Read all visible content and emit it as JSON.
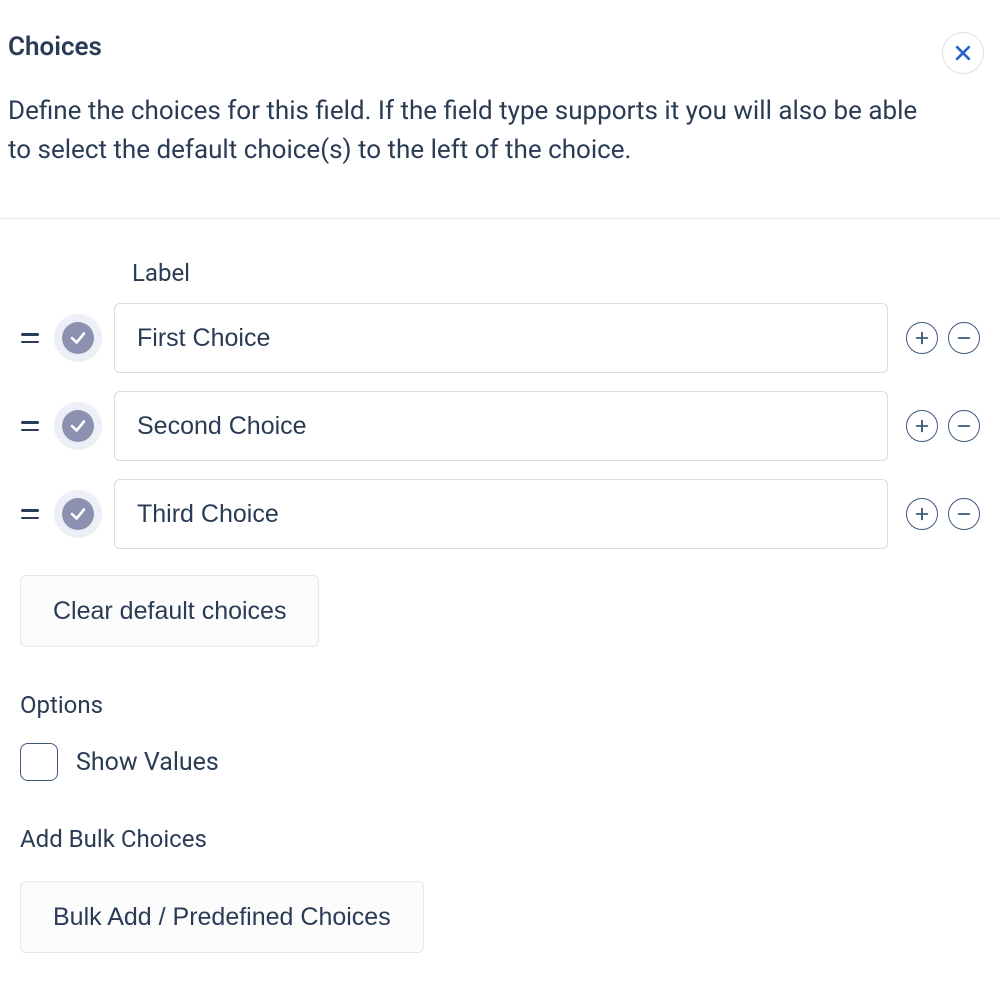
{
  "header": {
    "title": "Choices"
  },
  "description": "Define the choices for this field. If the field type supports it you will also be able to select the default choice(s) to the left of the choice.",
  "labelColumn": "Label",
  "choices": [
    {
      "value": "First Choice"
    },
    {
      "value": "Second Choice"
    },
    {
      "value": "Third Choice"
    }
  ],
  "buttons": {
    "clearDefaults": "Clear default choices",
    "bulkAdd": "Bulk Add / Predefined Choices"
  },
  "sections": {
    "options": "Options",
    "addBulk": "Add Bulk Choices"
  },
  "checkboxes": {
    "showValues": "Show Values"
  }
}
